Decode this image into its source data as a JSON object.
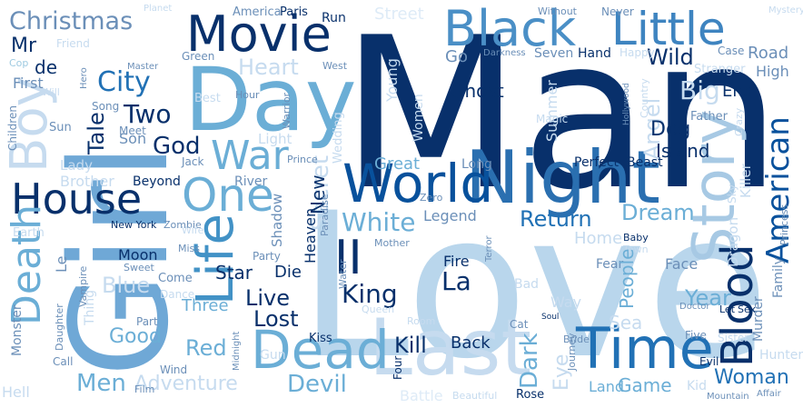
{
  "colors": {
    "background": "#ffffff",
    "palette": [
      "#08306b",
      "#08519c",
      "#2171b5",
      "#4292c6",
      "#6baed6",
      "#9ecae1",
      "#c6dbef",
      "#deebf7"
    ]
  },
  "words": [
    {
      "text": "Man",
      "color": "#08306b"
    },
    {
      "text": "Love",
      "color": "#b9d6ec"
    },
    {
      "text": "Girl",
      "color": "#6fa8d6"
    },
    {
      "text": "Night",
      "color": "#2a6fb0"
    },
    {
      "text": "World",
      "color": "#08519c"
    },
    {
      "text": "Story",
      "color": "#a7c9e4"
    },
    {
      "text": "Last",
      "color": "#c6dbef"
    },
    {
      "text": "Dead",
      "color": "#6baed6"
    },
    {
      "text": "Time",
      "color": "#2171b5"
    },
    {
      "text": "Day",
      "color": "#6baed6"
    },
    {
      "text": "Black",
      "color": "#4a8fc6"
    },
    {
      "text": "Little",
      "color": "#3e84c0"
    },
    {
      "text": "Movie",
      "color": "#08306b"
    },
    {
      "text": "House",
      "color": "#08306b"
    },
    {
      "text": "Boy",
      "color": "#c6dbef"
    },
    {
      "text": "Death",
      "color": "#6baed6"
    },
    {
      "text": "Life",
      "color": "#4292c6"
    },
    {
      "text": "One",
      "color": "#6baed6"
    },
    {
      "text": "War",
      "color": "#6baed6"
    },
    {
      "text": "Blood",
      "color": "#08306b"
    },
    {
      "text": "American",
      "color": "#08519c"
    },
    {
      "text": "Christmas",
      "color": "#6b8fb8"
    },
    {
      "text": "Mr",
      "color": "#08306b"
    },
    {
      "text": "de",
      "color": "#08306b"
    },
    {
      "text": "First",
      "color": "#6b8fb8"
    },
    {
      "text": "Cop",
      "color": "#9ecae1"
    },
    {
      "text": "Will",
      "color": "#c6dbef"
    },
    {
      "text": "Hero",
      "color": "#6b8fb8"
    },
    {
      "text": "Master",
      "color": "#6b8fb8"
    },
    {
      "text": "Green",
      "color": "#6b8fb8"
    },
    {
      "text": "Heart",
      "color": "#c6dbef"
    },
    {
      "text": "City",
      "color": "#2171b5"
    },
    {
      "text": "Two",
      "color": "#08306b"
    },
    {
      "text": "Song",
      "color": "#6b8fb8"
    },
    {
      "text": "Meet",
      "color": "#6b8fb8"
    },
    {
      "text": "Best",
      "color": "#c6dbef"
    },
    {
      "text": "Hour",
      "color": "#6b8fb8"
    },
    {
      "text": "Tale",
      "color": "#08306b"
    },
    {
      "text": "Son",
      "color": "#6b8fb8"
    },
    {
      "text": "God",
      "color": "#08306b"
    },
    {
      "text": "Sun",
      "color": "#6b8fb8"
    },
    {
      "text": "Children",
      "color": "#6b8fb8"
    },
    {
      "text": "Lady",
      "color": "#c6dbef"
    },
    {
      "text": "Brother",
      "color": "#c6dbef"
    },
    {
      "text": "Jack",
      "color": "#6b8fb8"
    },
    {
      "text": "Beyond",
      "color": "#08306b"
    },
    {
      "text": "River",
      "color": "#6b8fb8"
    },
    {
      "text": "Light",
      "color": "#c6dbef"
    },
    {
      "text": "Warrior",
      "color": "#6b8fb8"
    },
    {
      "text": "Wild",
      "color": "#08306b"
    },
    {
      "text": "Big",
      "color": "#c6dbef"
    },
    {
      "text": "Go",
      "color": "#6b8fb8"
    },
    {
      "text": "Ghost",
      "color": "#08306b"
    },
    {
      "text": "Young",
      "color": "#c6dbef"
    },
    {
      "text": "Seven",
      "color": "#6b8fb8"
    },
    {
      "text": "Hand",
      "color": "#08306b"
    },
    {
      "text": "Darkness",
      "color": "#6b8fb8"
    },
    {
      "text": "Road",
      "color": "#6b8fb8"
    },
    {
      "text": "High",
      "color": "#6b8fb8"
    },
    {
      "text": "Stranger",
      "color": "#c6dbef"
    },
    {
      "text": "End",
      "color": "#08306b"
    },
    {
      "text": "Angel",
      "color": "#c6dbef"
    },
    {
      "text": "Summer",
      "color": "#c6dbef"
    },
    {
      "text": "Women",
      "color": "#c6dbef"
    },
    {
      "text": "Magic",
      "color": "#c6dbef"
    },
    {
      "text": "Hollywood",
      "color": "#6b8fb8"
    },
    {
      "text": "Father",
      "color": "#6b8fb8"
    },
    {
      "text": "Dog",
      "color": "#08306b"
    },
    {
      "text": "Island",
      "color": "#08306b"
    },
    {
      "text": "Country",
      "color": "#c6dbef"
    },
    {
      "text": "Crazy",
      "color": "#c6dbef"
    },
    {
      "text": "Killer",
      "color": "#c6dbef"
    },
    {
      "text": "Perfect",
      "color": "#08306b"
    },
    {
      "text": "Beast",
      "color": "#08306b"
    },
    {
      "text": "Long",
      "color": "#6b8fb8"
    },
    {
      "text": "Great",
      "color": "#6baed6"
    },
    {
      "text": "Secret",
      "color": "#c6dbef"
    },
    {
      "text": "New",
      "color": "#08306b"
    },
    {
      "text": "Prince",
      "color": "#6b8fb8"
    },
    {
      "text": "Wedding",
      "color": "#c6dbef"
    },
    {
      "text": "Paradise",
      "color": "#6b8fb8"
    },
    {
      "text": "Shadow",
      "color": "#6b8fb8"
    },
    {
      "text": "Heaven",
      "color": "#08306b"
    },
    {
      "text": "White",
      "color": "#6baed6"
    },
    {
      "text": "Return",
      "color": "#2171b5"
    },
    {
      "text": "Legend",
      "color": "#6b8fb8"
    },
    {
      "text": "Zero",
      "color": "#6b8fb8"
    },
    {
      "text": "Dream",
      "color": "#6baed6"
    },
    {
      "text": "Home",
      "color": "#c6dbef"
    },
    {
      "text": "Princess",
      "color": "#6b8fb8"
    },
    {
      "text": "Sky",
      "color": "#c6dbef"
    },
    {
      "text": "Family",
      "color": "#6b8fb8"
    },
    {
      "text": "Dragon",
      "color": "#c6dbef"
    },
    {
      "text": "Baby",
      "color": "#08306b"
    },
    {
      "text": "Town",
      "color": "#c6dbef"
    },
    {
      "text": "Fear",
      "color": "#6b8fb8"
    },
    {
      "text": "Face",
      "color": "#6b8fb8"
    },
    {
      "text": "Murder",
      "color": "#6b8fb8"
    },
    {
      "text": "Year",
      "color": "#6baed6"
    },
    {
      "text": "People",
      "color": "#6baed6"
    },
    {
      "text": "Sea",
      "color": "#c6dbef"
    },
    {
      "text": "II",
      "color": "#08306b"
    },
    {
      "text": "King",
      "color": "#08306b"
    },
    {
      "text": "La",
      "color": "#08306b"
    },
    {
      "text": "Fire",
      "color": "#08306b"
    },
    {
      "text": "Live",
      "color": "#08306b"
    },
    {
      "text": "Lost",
      "color": "#08306b"
    },
    {
      "text": "Star",
      "color": "#08306b"
    },
    {
      "text": "Die",
      "color": "#08306b"
    },
    {
      "text": "Party",
      "color": "#6b8fb8"
    },
    {
      "text": "Mother",
      "color": "#6b8fb8"
    },
    {
      "text": "Water",
      "color": "#6b8fb8"
    },
    {
      "text": "Terror",
      "color": "#6b8fb8"
    },
    {
      "text": "Moon",
      "color": "#08306b"
    },
    {
      "text": "Sweet",
      "color": "#6b8fb8"
    },
    {
      "text": "Miss",
      "color": "#6b8fb8"
    },
    {
      "text": "Zombie",
      "color": "#6b8fb8"
    },
    {
      "text": "Wife",
      "color": "#c6dbef"
    },
    {
      "text": "New York",
      "color": "#08306b"
    },
    {
      "text": "Earth",
      "color": "#c6dbef"
    },
    {
      "text": "Le",
      "color": "#6b8fb8"
    },
    {
      "text": "Blue",
      "color": "#c6dbef"
    },
    {
      "text": "Come",
      "color": "#6b8fb8"
    },
    {
      "text": "Dance",
      "color": "#c6dbef"
    },
    {
      "text": "Vampire",
      "color": "#6b8fb8"
    },
    {
      "text": "Three",
      "color": "#6baed6"
    },
    {
      "text": "Good",
      "color": "#6baed6"
    },
    {
      "text": "Red",
      "color": "#6baed6"
    },
    {
      "text": "Part",
      "color": "#6b8fb8"
    },
    {
      "text": "Monster",
      "color": "#6b8fb8"
    },
    {
      "text": "Daughter",
      "color": "#6b8fb8"
    },
    {
      "text": "Thing",
      "color": "#c6dbef"
    },
    {
      "text": "Call",
      "color": "#6b8fb8"
    },
    {
      "text": "Wind",
      "color": "#6b8fb8"
    },
    {
      "text": "Midnight",
      "color": "#6b8fb8"
    },
    {
      "text": "Gun",
      "color": "#c6dbef"
    },
    {
      "text": "Kiss",
      "color": "#08306b"
    },
    {
      "text": "Room",
      "color": "#c6dbef"
    },
    {
      "text": "Queen",
      "color": "#c6dbef"
    },
    {
      "text": "Kill",
      "color": "#08306b"
    },
    {
      "text": "Back",
      "color": "#08306b"
    },
    {
      "text": "Dark",
      "color": "#6baed6"
    },
    {
      "text": "Bad",
      "color": "#c6dbef"
    },
    {
      "text": "Way",
      "color": "#c6dbef"
    },
    {
      "text": "Cat",
      "color": "#6b8fb8"
    },
    {
      "text": "Soul",
      "color": "#08306b"
    },
    {
      "text": "Bride",
      "color": "#6b8fb8"
    },
    {
      "text": "Journey",
      "color": "#6b8fb8"
    },
    {
      "text": "Eye",
      "color": "#c6dbef"
    },
    {
      "text": "Land",
      "color": "#6baed6"
    },
    {
      "text": "Game",
      "color": "#6baed6"
    },
    {
      "text": "Five",
      "color": "#6b8fb8"
    },
    {
      "text": "Sister",
      "color": "#c6dbef"
    },
    {
      "text": "Let",
      "color": "#08306b"
    },
    {
      "text": "Sex",
      "color": "#08306b"
    },
    {
      "text": "Doctor",
      "color": "#6b8fb8"
    },
    {
      "text": "Evil",
      "color": "#08306b"
    },
    {
      "text": "Woman",
      "color": "#2171b5"
    },
    {
      "text": "Hunter",
      "color": "#c6dbef"
    },
    {
      "text": "Kid",
      "color": "#c6dbef"
    },
    {
      "text": "Mountain",
      "color": "#6b8fb8"
    },
    {
      "text": "Affair",
      "color": "#6b8fb8"
    },
    {
      "text": "Rose",
      "color": "#08306b"
    },
    {
      "text": "Beautiful",
      "color": "#c6dbef"
    },
    {
      "text": "Battle",
      "color": "#deebf7"
    },
    {
      "text": "Four",
      "color": "#08306b"
    },
    {
      "text": "Devil",
      "color": "#6baed6"
    },
    {
      "text": "Men",
      "color": "#6baed6"
    },
    {
      "text": "Adventure",
      "color": "#c6dbef"
    },
    {
      "text": "Film",
      "color": "#6b8fb8"
    },
    {
      "text": "Hell",
      "color": "#c6dbef"
    },
    {
      "text": "America",
      "color": "#6b8fb8"
    },
    {
      "text": "Paris",
      "color": "#08306b"
    },
    {
      "text": "Run",
      "color": "#08306b"
    },
    {
      "text": "Street",
      "color": "#deebf7"
    },
    {
      "text": "Planet",
      "color": "#c6dbef"
    },
    {
      "text": "Friend",
      "color": "#c6dbef"
    },
    {
      "text": "Without",
      "color": "#6b8fb8"
    },
    {
      "text": "Never",
      "color": "#6b8fb8"
    },
    {
      "text": "Mystery",
      "color": "#c6dbef"
    },
    {
      "text": "Case",
      "color": "#6b8fb8"
    },
    {
      "text": "West",
      "color": "#6b8fb8"
    },
    {
      "text": "Happy",
      "color": "#c6dbef"
    }
  ]
}
